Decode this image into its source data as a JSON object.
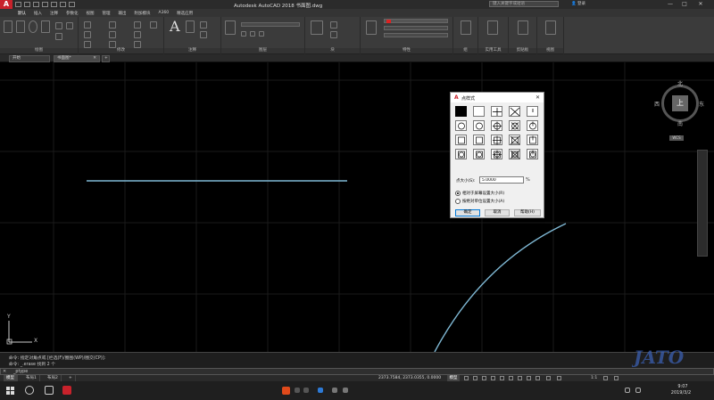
{
  "title_bar": {
    "window_title": "Autodesk AutoCAD 2018   书面图.dwg",
    "search_placeholder": "键入关键字或短语",
    "login_text": "登录",
    "minimize": "—",
    "maximize": "□",
    "close": "✕"
  },
  "menu_tabs": [
    "默认",
    "插入",
    "注释",
    "参数化",
    "视图",
    "管理",
    "输出",
    "附加模块",
    "A360",
    "精选应用"
  ],
  "ribbon_panels": [
    "绘图",
    "修改",
    "注释",
    "图层",
    "块",
    "特性",
    "组",
    "实用工具",
    "剪贴板",
    "视图"
  ],
  "doc_tabs": [
    "开始",
    "书面图*"
  ],
  "viewcube": {
    "face": "上",
    "north": "北",
    "south": "南",
    "east": "东",
    "west": "西",
    "wcs": "WCS"
  },
  "ucs": {
    "x": "X",
    "y": "Y"
  },
  "dialog": {
    "title": "点样式",
    "close": "✕",
    "size_label": "点大小(S):",
    "size_value": "5.0000",
    "size_unit": "%",
    "radio_relative": "相对于屏幕设置大小(R)",
    "radio_absolute": "按绝对单位设置大小(A)",
    "radio_selected": "relative",
    "ok": "确定",
    "cancel": "取消",
    "help": "帮助(H)",
    "selected_style_index": 0
  },
  "command": {
    "history_1": "命令: 指定对角点或 [栏选(F)/圈围(WP)/圈交(CP)]:",
    "history_2": "命令: _.erase 找到 2 个",
    "prompt": "_ptype",
    "close_icon": "✕"
  },
  "layout_tabs": [
    "模型",
    "布局1",
    "布局2",
    "+"
  ],
  "status_bar": {
    "coords": "2373.7584, 2373.0355, 0.0000",
    "model": "模型",
    "scale": "1:1"
  },
  "taskbar": {
    "time": "9:07",
    "date": "2019/3/2"
  },
  "watermark": "JATO",
  "colors": {
    "accent": "#c8222b",
    "curve": "#7fb8d4",
    "background": "#000000"
  }
}
